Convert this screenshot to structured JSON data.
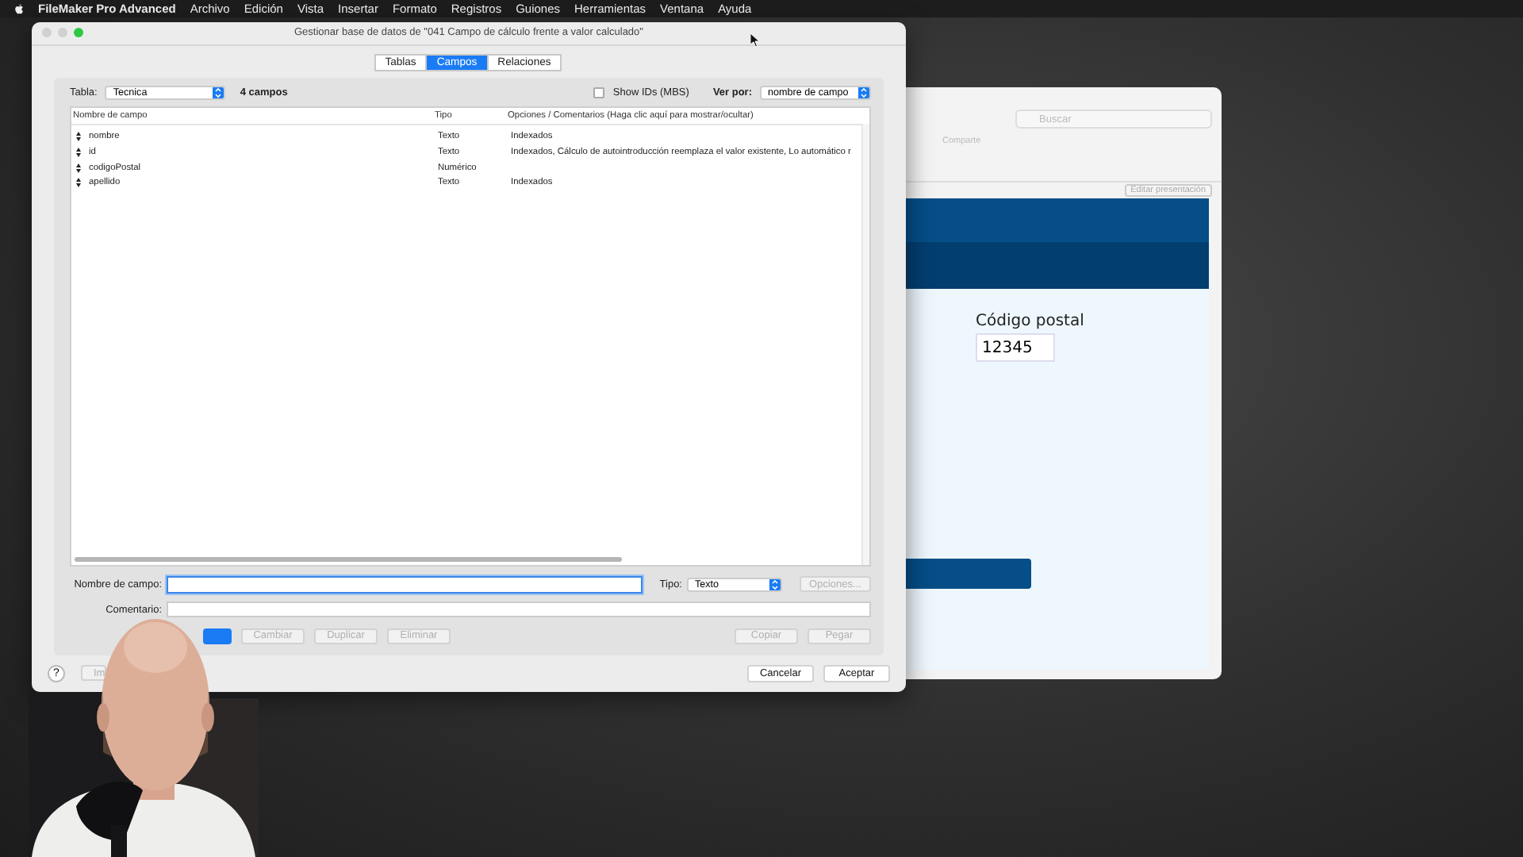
{
  "menu_bar": {
    "app_name": "FileMaker Pro Advanced",
    "items": [
      "Archivo",
      "Edición",
      "Vista",
      "Insertar",
      "Formato",
      "Registros",
      "Guiones",
      "Herramientas",
      "Ventana",
      "Ayuda"
    ]
  },
  "background_window": {
    "search": {
      "placeholder": "Buscar"
    },
    "toolbar_label": "Comparte",
    "edit_layout_button": "Editar presentación",
    "field_label": "Código postal",
    "field_value": "12345"
  },
  "dialog": {
    "title": "Gestionar base de datos de \"041 Campo de cálculo frente a valor calculado\"",
    "tabs": [
      {
        "label": "Tablas",
        "selected": false
      },
      {
        "label": "Campos",
        "selected": true
      },
      {
        "label": "Relaciones",
        "selected": false
      }
    ],
    "table_label": "Tabla:",
    "table_value": "Tecnica",
    "field_count": "4 campos",
    "show_ids": {
      "label": "Show IDs (MBS)",
      "checked": false
    },
    "view_by": {
      "label": "Ver por:",
      "value": "nombre de campo"
    },
    "columns": [
      "Nombre de campo",
      "Tipo",
      "Opciones / Comentarios (Haga clic aquí para mostrar/ocultar)"
    ],
    "rows": [
      {
        "name": "nombre",
        "type": "Texto",
        "options": "Indexados"
      },
      {
        "name": "id",
        "type": "Texto",
        "options": "Indexados, Cálculo de autointroducción reemplaza el valor existente, Lo automático r"
      },
      {
        "name": "codigoPostal",
        "type": "Numérico"
      },
      {
        "name": "apellido",
        "type": "Texto",
        "options": "Indexados"
      }
    ],
    "field_name_label": "Nombre de campo:",
    "type_label": "Tipo:",
    "type_value": "Texto",
    "options_button": {
      "label": "Opciones...",
      "disabled": true
    },
    "comment_label": "Comentario:",
    "action_buttons": [
      {
        "kind": "primary",
        "disabled": false
      },
      {
        "label": "Cambiar",
        "disabled": true
      },
      {
        "label": "Duplicar",
        "disabled": true
      },
      {
        "label": "Eliminar",
        "disabled": true
      }
    ],
    "clipboard_buttons": [
      {
        "label": "Copiar",
        "disabled": true
      },
      {
        "label": "Pegar",
        "disabled": true
      }
    ],
    "help_button": "?",
    "import_button": {
      "label": "Im",
      "disabled": true
    },
    "footer_buttons": [
      "Cancelar",
      "Aceptar"
    ]
  }
}
